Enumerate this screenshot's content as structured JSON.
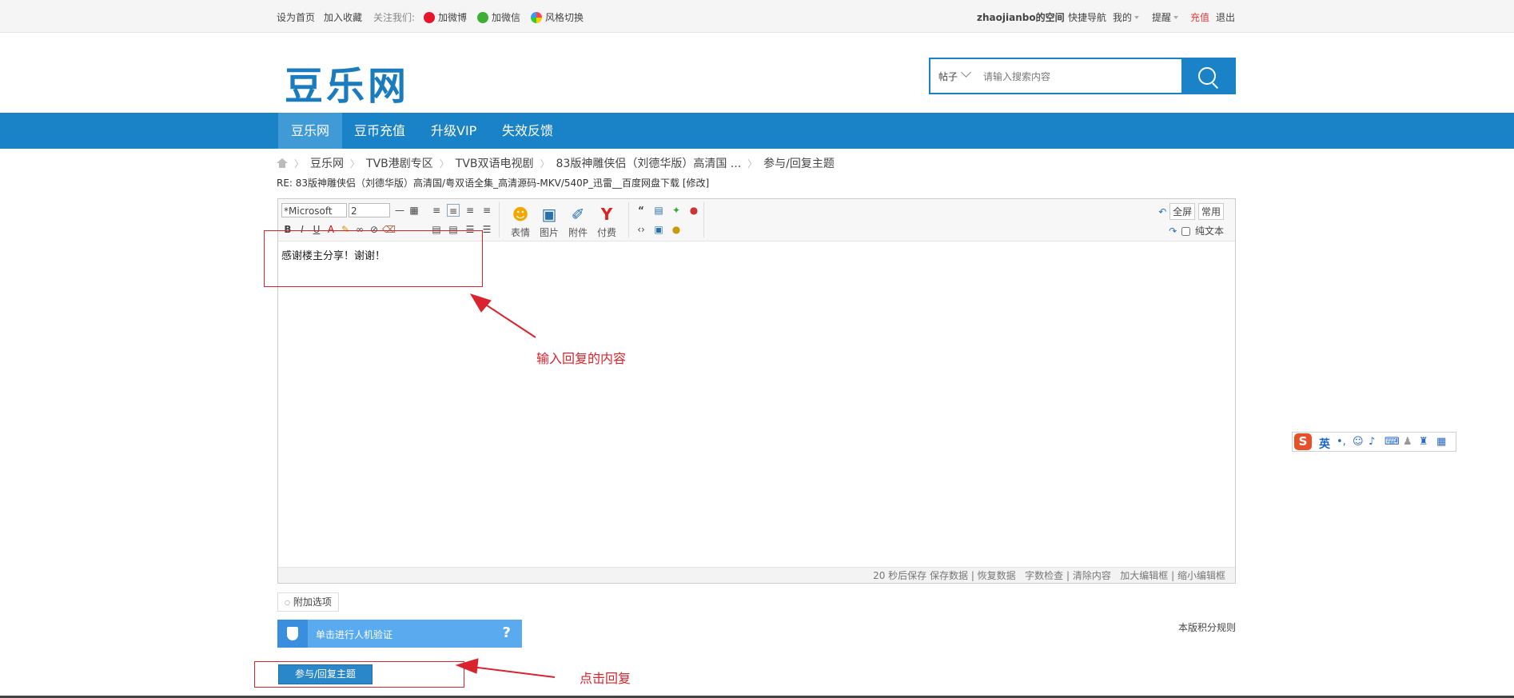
{
  "topbar": {
    "set_home": "设为首页",
    "add_fav": "加入收藏",
    "follow_us": "关注我们:",
    "weibo": "加微博",
    "wechat": "加微信",
    "style_switch": "风格切换",
    "username": "zhaojianbo的空间",
    "quick_nav": "快捷导航",
    "mine": "我的",
    "remind": "提醒",
    "recharge": "充值",
    "logout": "退出"
  },
  "header": {
    "logo": "豆乐网",
    "search_type": "帖子",
    "search_placeholder": "请输入搜索内容"
  },
  "nav": {
    "items": [
      {
        "label": "豆乐网",
        "active": true
      },
      {
        "label": "豆币充值"
      },
      {
        "label": "升级VIP"
      },
      {
        "label": "失效反馈"
      }
    ]
  },
  "breadcrumb": {
    "items": [
      "豆乐网",
      "TVB港剧专区",
      "TVB双语电视剧",
      "83版神雕侠侣（刘德华版）高清国 ...",
      "参与/回复主题"
    ]
  },
  "thread_title": "RE: 83版神雕侠侣（刘德华版）高清国/粤双语全集_高清源码-MKV/540P_迅雷__百度网盘下载 [修改]",
  "editor": {
    "font_select": "*Microsoft",
    "size_select": "2",
    "emoji_label": "表情",
    "image_label": "图片",
    "attach_label": "附件",
    "pay_label": "付费",
    "fullscreen": "全屏",
    "common": "常用",
    "plain_text": "纯文本",
    "content": "感谢楼主分享！谢谢！",
    "status": {
      "autosave": "20 秒后保存",
      "save_data": "保存数据",
      "restore_data": "恢复数据",
      "word_check": "字数检查",
      "clear": "清除内容",
      "enlarge": "加大编辑框",
      "shrink": "缩小编辑框"
    }
  },
  "extra_options": "附加选项",
  "credit_rules": "本版积分规则",
  "verify": {
    "label": "单击进行人机验证",
    "help": "?"
  },
  "submit_label": "参与/回复主题",
  "annotations": {
    "input_tip": "输入回复的内容",
    "click_tip": "点击回复"
  },
  "ime": {
    "logo": "S",
    "lang": "英"
  },
  "colors": {
    "brand_blue": "#1a82c6",
    "annotation_red": "#d9232d",
    "recharge_red": "#e4393c"
  }
}
